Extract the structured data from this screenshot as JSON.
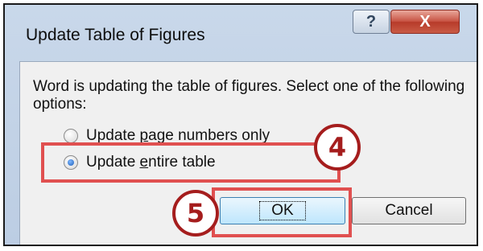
{
  "dialog": {
    "title": "Update Table of Figures",
    "help_glyph": "?",
    "close_glyph": "X",
    "message": "Word is updating the table of figures.  Select one of the following options:"
  },
  "options": [
    {
      "label_pre": "Update ",
      "label_key": "p",
      "label_post": "age numbers only",
      "checked": false
    },
    {
      "label_pre": "Update ",
      "label_key": "e",
      "label_post": "ntire table",
      "checked": true
    }
  ],
  "buttons": {
    "ok": "OK",
    "cancel": "Cancel"
  },
  "callouts": {
    "step_options": "4",
    "step_ok": "5"
  },
  "colors": {
    "highlight": "#e05050",
    "badge": "#a51d1d"
  }
}
